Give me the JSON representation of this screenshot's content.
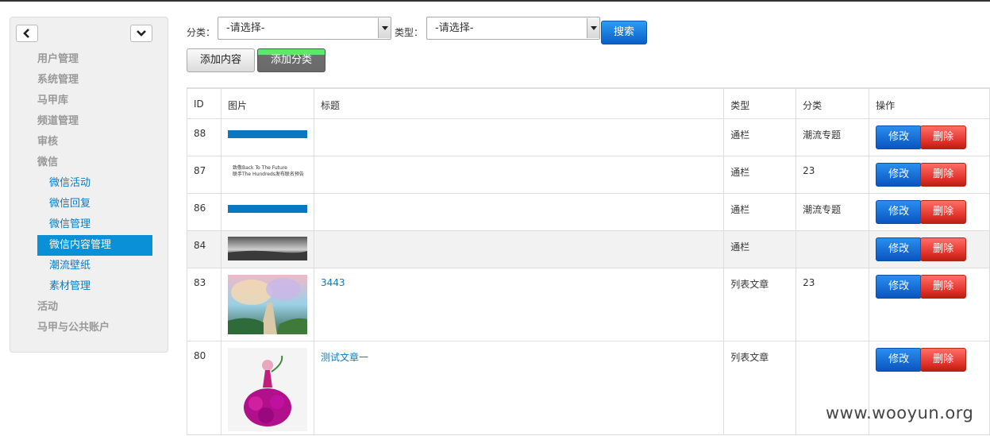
{
  "sidebar": {
    "menu": [
      {
        "label": "用户管理",
        "sub": false
      },
      {
        "label": "系统管理",
        "sub": false
      },
      {
        "label": "马甲库",
        "sub": false
      },
      {
        "label": "频道管理",
        "sub": false
      },
      {
        "label": "审核",
        "sub": false
      },
      {
        "label": "微信",
        "sub": false
      },
      {
        "label": "微信活动",
        "sub": true
      },
      {
        "label": "微信回复",
        "sub": true
      },
      {
        "label": "微信管理",
        "sub": true
      },
      {
        "label": "微信内容管理",
        "sub": true,
        "active": true
      },
      {
        "label": "潮流壁纸",
        "sub": true
      },
      {
        "label": "素材管理",
        "sub": true
      },
      {
        "label": "活动",
        "sub": false
      },
      {
        "label": "马甲与公共账户",
        "sub": false
      }
    ]
  },
  "toolbar": {
    "category_label": "分类：",
    "category_value": "-请选择-",
    "type_label": "类型：",
    "type_value": "-请选择-",
    "search_label": "搜索",
    "add_content_label": "添加内容",
    "add_category_label": "添加分类"
  },
  "table": {
    "headers": {
      "id": "ID",
      "image": "图片",
      "title": "标题",
      "type": "类型",
      "category": "分类",
      "ops": "操作"
    },
    "edit_label": "修改",
    "delete_label": "删除",
    "rows": [
      {
        "id": "88",
        "image": "blue-banner",
        "title": "",
        "type": "通栏",
        "category": "潮流专题"
      },
      {
        "id": "87",
        "image": "text-banner",
        "image_text": [
          "致敬Back To The Future",
          "联手The Hundreds发布联名预告"
        ],
        "title": "",
        "type": "通栏",
        "category": "23"
      },
      {
        "id": "86",
        "image": "blue-banner",
        "title": "",
        "type": "通栏",
        "category": "潮流专题"
      },
      {
        "id": "84",
        "image": "gray-landscape",
        "title": "",
        "type": "通栏",
        "category": ""
      },
      {
        "id": "83",
        "image": "fantasy-stairs",
        "title": "3443",
        "type": "列表文章",
        "category": "23"
      },
      {
        "id": "80",
        "image": "flower-dress",
        "title": "测试文章一",
        "type": "列表文章",
        "category": ""
      }
    ]
  },
  "watermark": "www.wooyun.org"
}
